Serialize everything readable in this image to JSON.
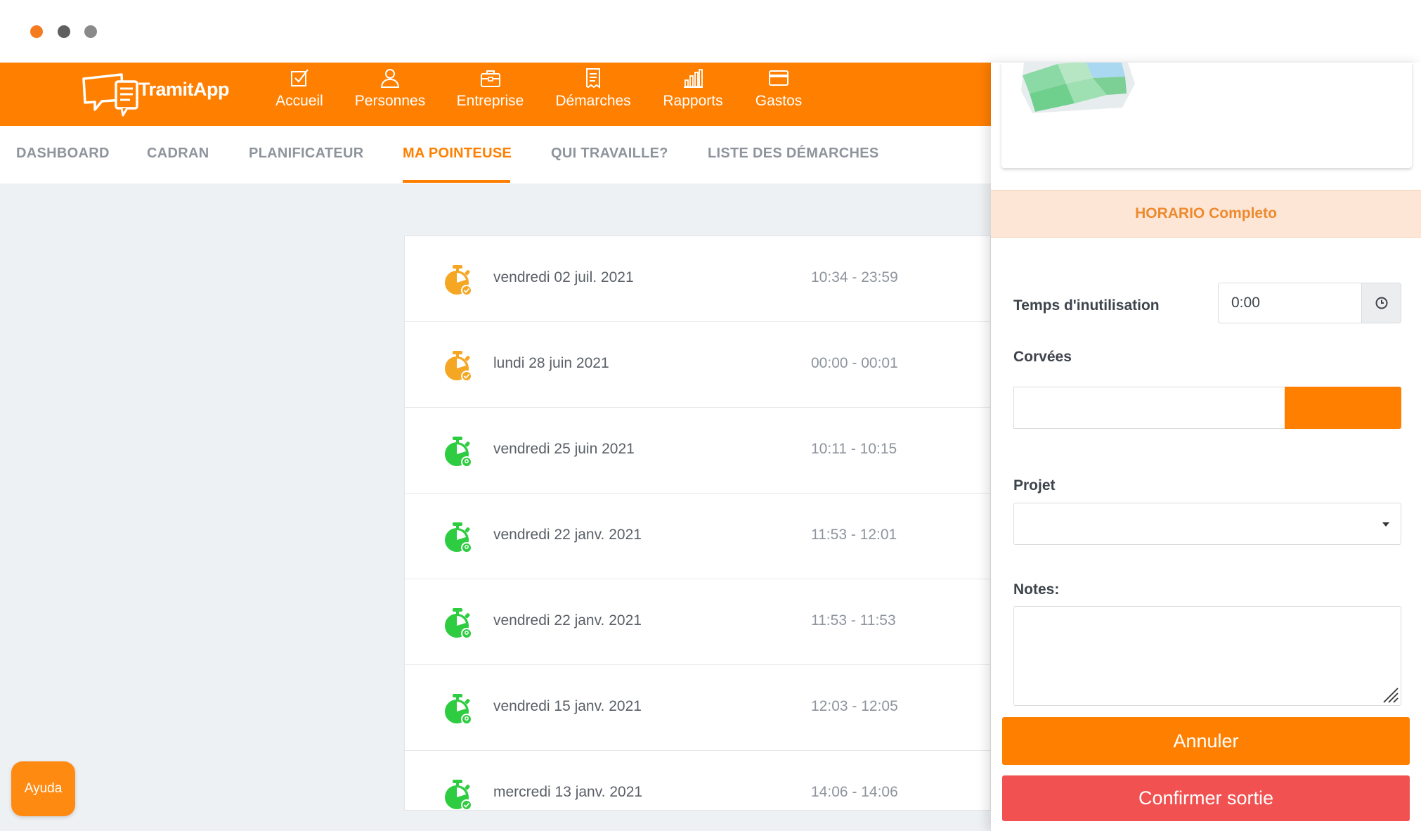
{
  "window": {
    "dot_colors": [
      "#f47b20",
      "#5f5f5f",
      "#8a8a8a"
    ]
  },
  "brand": {
    "name_part1": "Tramit",
    "name_part2": "App",
    "accent": "#ff7f00"
  },
  "topnav": {
    "items": [
      {
        "label": "Accueil",
        "icon": "checkbox-icon"
      },
      {
        "label": "Personnes",
        "icon": "person-icon"
      },
      {
        "label": "Entreprise",
        "icon": "briefcase-icon"
      },
      {
        "label": "Démarches",
        "icon": "document-icon"
      },
      {
        "label": "Rapports",
        "icon": "bar-chart-icon"
      },
      {
        "label": "Gastos",
        "icon": "credit-card-icon"
      }
    ]
  },
  "subtabs": {
    "items": [
      "DASHBOARD",
      "CADRAN",
      "PLANIFICATEUR",
      "MA POINTEUSE",
      "QUI TRAVAILLE?",
      "LISTE DES DÉMARCHES"
    ],
    "active": "MA POINTEUSE"
  },
  "entries": [
    {
      "date": "vendredi 02 juil. 2021",
      "range": "10:34 - 23:59",
      "status": "orange"
    },
    {
      "date": "lundi 28 juin 2021",
      "range": "00:00 - 00:01",
      "status": "orange"
    },
    {
      "date": "vendredi 25 juin 2021",
      "range": "10:11 - 10:15",
      "status": "green"
    },
    {
      "date": "vendredi 22 janv. 2021",
      "range": "11:53 - 12:01",
      "status": "green"
    },
    {
      "date": "vendredi 22 janv. 2021",
      "range": "11:53 - 11:53",
      "status": "green"
    },
    {
      "date": "vendredi 15 janv. 2021",
      "range": "12:03 - 12:05",
      "status": "green"
    },
    {
      "date": "mercredi 13 janv. 2021",
      "range": "14:06 - 14:06",
      "status": "green"
    }
  ],
  "status_colors": {
    "orange": "#f5a623",
    "green": "#2ecc40"
  },
  "help": {
    "label": "Ayuda"
  },
  "panel": {
    "schedule": "HORARIO Completo",
    "usage_time_label": "Temps d'inutilisation",
    "usage_time_value": "0:00",
    "chores_label": "Corvées",
    "project_label": "Projet",
    "notes_label": "Notes:",
    "cancel_label": "Annuler",
    "confirm_label": "Confirmer sortie",
    "cancel_color": "#ff7f00",
    "confirm_color": "#f15150"
  }
}
